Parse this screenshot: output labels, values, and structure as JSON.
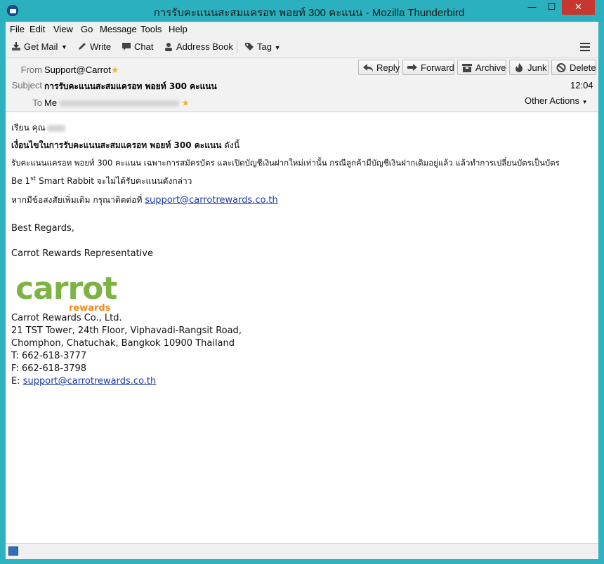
{
  "window": {
    "title": "การรับคะแนนสะสมแครอท พอยท์ 300 คะแนน - Mozilla Thunderbird",
    "min": "—",
    "max": "☐",
    "close": "✕"
  },
  "menu": [
    "File",
    "Edit",
    "View",
    "Go",
    "Message",
    "Tools",
    "Help"
  ],
  "toolbar": {
    "get_mail": "Get Mail",
    "write": "Write",
    "chat": "Chat",
    "address_book": "Address Book",
    "tag": "Tag"
  },
  "header": {
    "from_label": "From",
    "from_value": "Support@Carrot",
    "subject_label": "Subject",
    "subject_value": "การรับคะแนนสะสมแครอท พอยท์ 300 คะแนน",
    "to_label": "To",
    "to_value": "Me",
    "time": "12:04",
    "actions": {
      "reply": "Reply",
      "forward": "Forward",
      "archive": "Archive",
      "junk": "Junk",
      "delete": "Delete",
      "other": "Other Actions"
    }
  },
  "body": {
    "greeting": "เรียน คุณ",
    "heading_bold": "เงื่อนไขในการรับคะแนนสะสมแครอท พอยท์ 300 คะแนน",
    "heading_rest": " ดังนี้",
    "line1": "รับคะแนนแครอท พอยท์ 300 คะแนน เฉพาะการสมัครบัตร และเปิดบัญชีเงินฝากใหม่เท่านั้น กรณีลูกค้ามีบัญชีเงินฝากเดิมอยู่แล้ว แล้วทำการเปลี่ยนบัตรเป็นบัตร",
    "line2_pre": "Be 1",
    "line2_sup": "st",
    "line2_post": " Smart Rabbit จะไม่ได้รับคะแนนดังกล่าว",
    "line3": "หากมีข้อสงสัยเพิ่มเติม กรุณาติดต่อที่ ",
    "email": "support@carrotrewards.co.th",
    "regards": "Best Regards,",
    "rep": "Carrot Rewards Representative",
    "logo_word": "carrot",
    "logo_sub": "rewards",
    "company": "Carrot Rewards Co., Ltd.",
    "addr1": "21 TST Tower, 24th Floor, Viphavadi-Rangsit Road,",
    "addr2": "Chomphon, Chatuchak, Bangkok 10900 Thailand",
    "tel": "T: 662-618-3777",
    "fax": "F: 662-618-3798",
    "email_label": "E: ",
    "email2": "support@carrotrewards.co.th"
  },
  "colors": {
    "titlebar": "#2ab0bf",
    "close": "#c7372f",
    "link": "#1a3aa6",
    "logo_green": "#7cb342",
    "logo_orange": "#f08a1c"
  }
}
